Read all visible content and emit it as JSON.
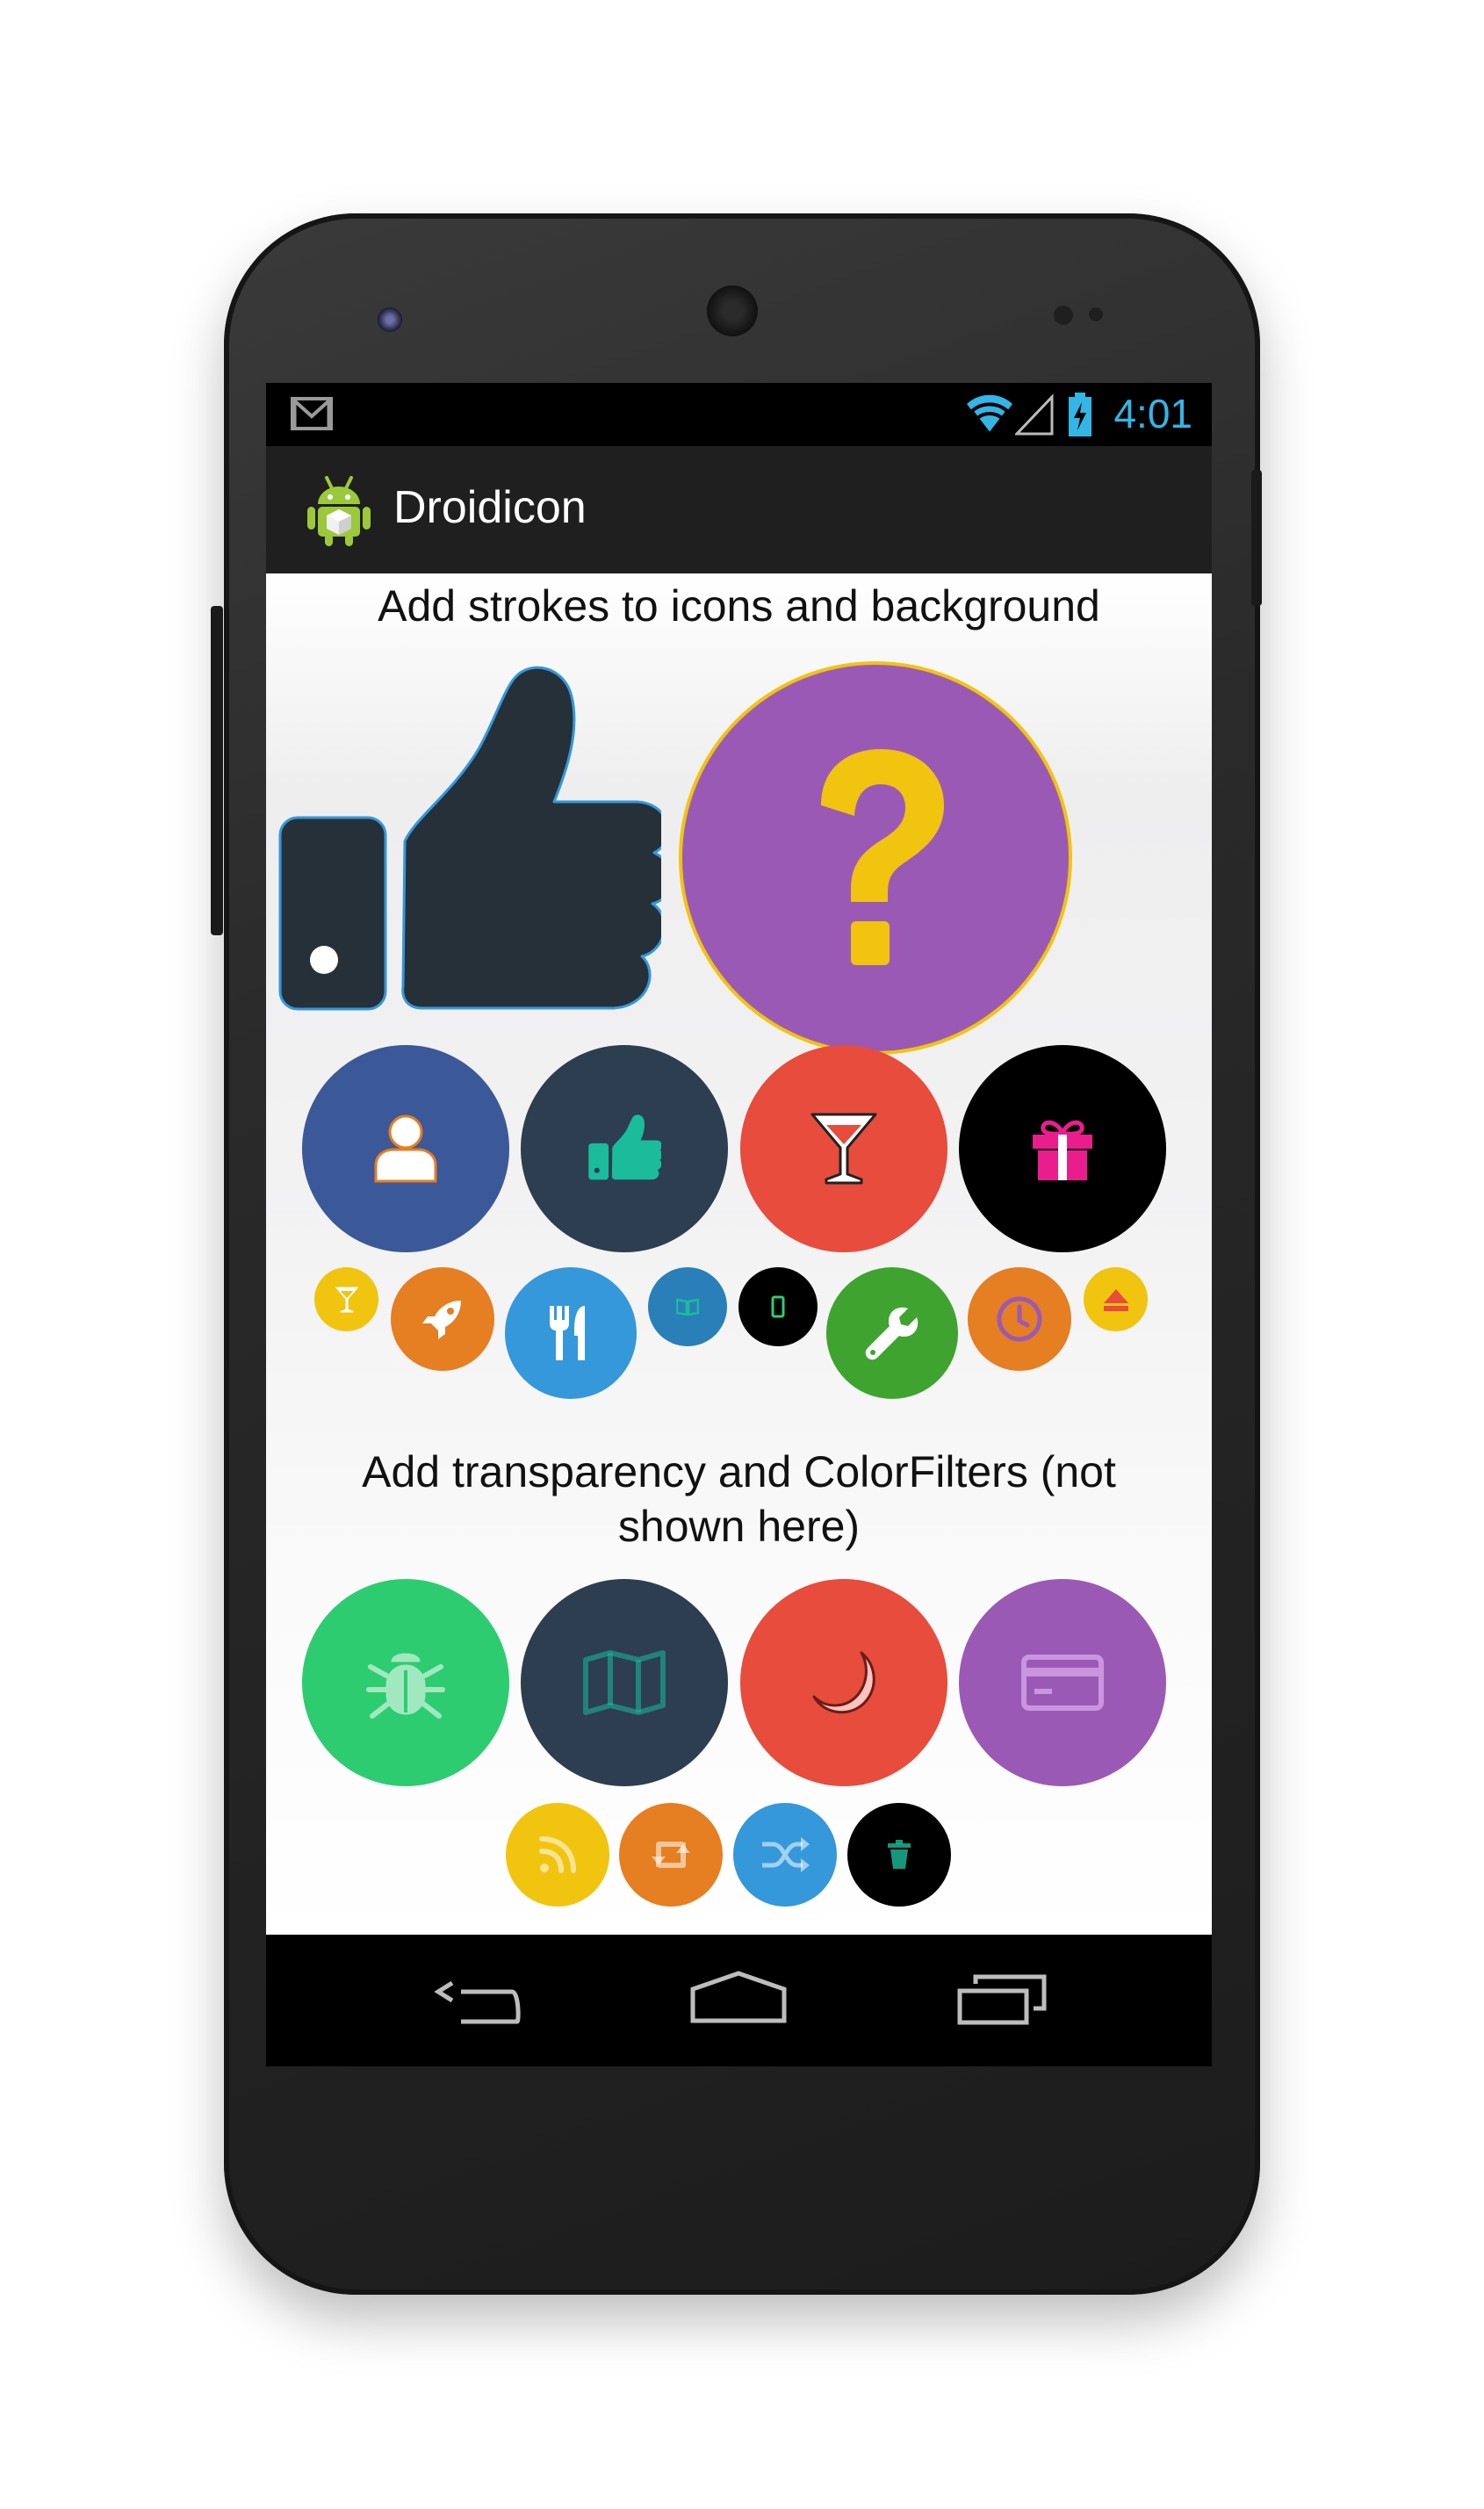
{
  "app": {
    "title": "Droidicon",
    "time": "4:01"
  },
  "sections": {
    "strokes_heading": "Add strokes to icons and background",
    "transparency_heading": "Add transparency and ColorFilters (not shown here)"
  },
  "icons": {
    "row_large_1": [
      {
        "name": "user-icon",
        "bg": "#3b5998"
      },
      {
        "name": "thumbs-up-icon",
        "bg": "#2c3e50"
      },
      {
        "name": "glass-icon",
        "bg": "#e74c3c"
      },
      {
        "name": "gift-icon",
        "bg": "#000000"
      }
    ],
    "row_small_1": [
      {
        "name": "glass-icon",
        "bg": "#f1c40f"
      },
      {
        "name": "rocket-icon",
        "bg": "#e67e22"
      },
      {
        "name": "cutlery-icon",
        "bg": "#3498db"
      },
      {
        "name": "book-icon",
        "bg": "#2980b9"
      },
      {
        "name": "mobile-icon",
        "bg": "#000000"
      },
      {
        "name": "wrench-icon",
        "bg": "#3ea42f"
      },
      {
        "name": "clock-icon",
        "bg": "#e67e22"
      },
      {
        "name": "eject-icon",
        "bg": "#f1c40f"
      }
    ],
    "row_large_2": [
      {
        "name": "bug-icon",
        "bg": "#2ecc71"
      },
      {
        "name": "map-icon",
        "bg": "#2c3e50"
      },
      {
        "name": "moon-icon",
        "bg": "#e74c3c"
      },
      {
        "name": "credit-card-icon",
        "bg": "#9b59b6"
      }
    ],
    "row_small_2": [
      {
        "name": "rss-icon",
        "bg": "#f1c40f"
      },
      {
        "name": "retweet-icon",
        "bg": "#e67e22"
      },
      {
        "name": "random-icon",
        "bg": "#3498db"
      },
      {
        "name": "trash-icon",
        "bg": "#000000"
      }
    ]
  },
  "colors": {
    "accent": "#33b5e5",
    "question_bg": "#9b59b6",
    "question_fg": "#f1c40f",
    "thumb_fg": "#263038",
    "thumb_stroke": "#3498db"
  }
}
